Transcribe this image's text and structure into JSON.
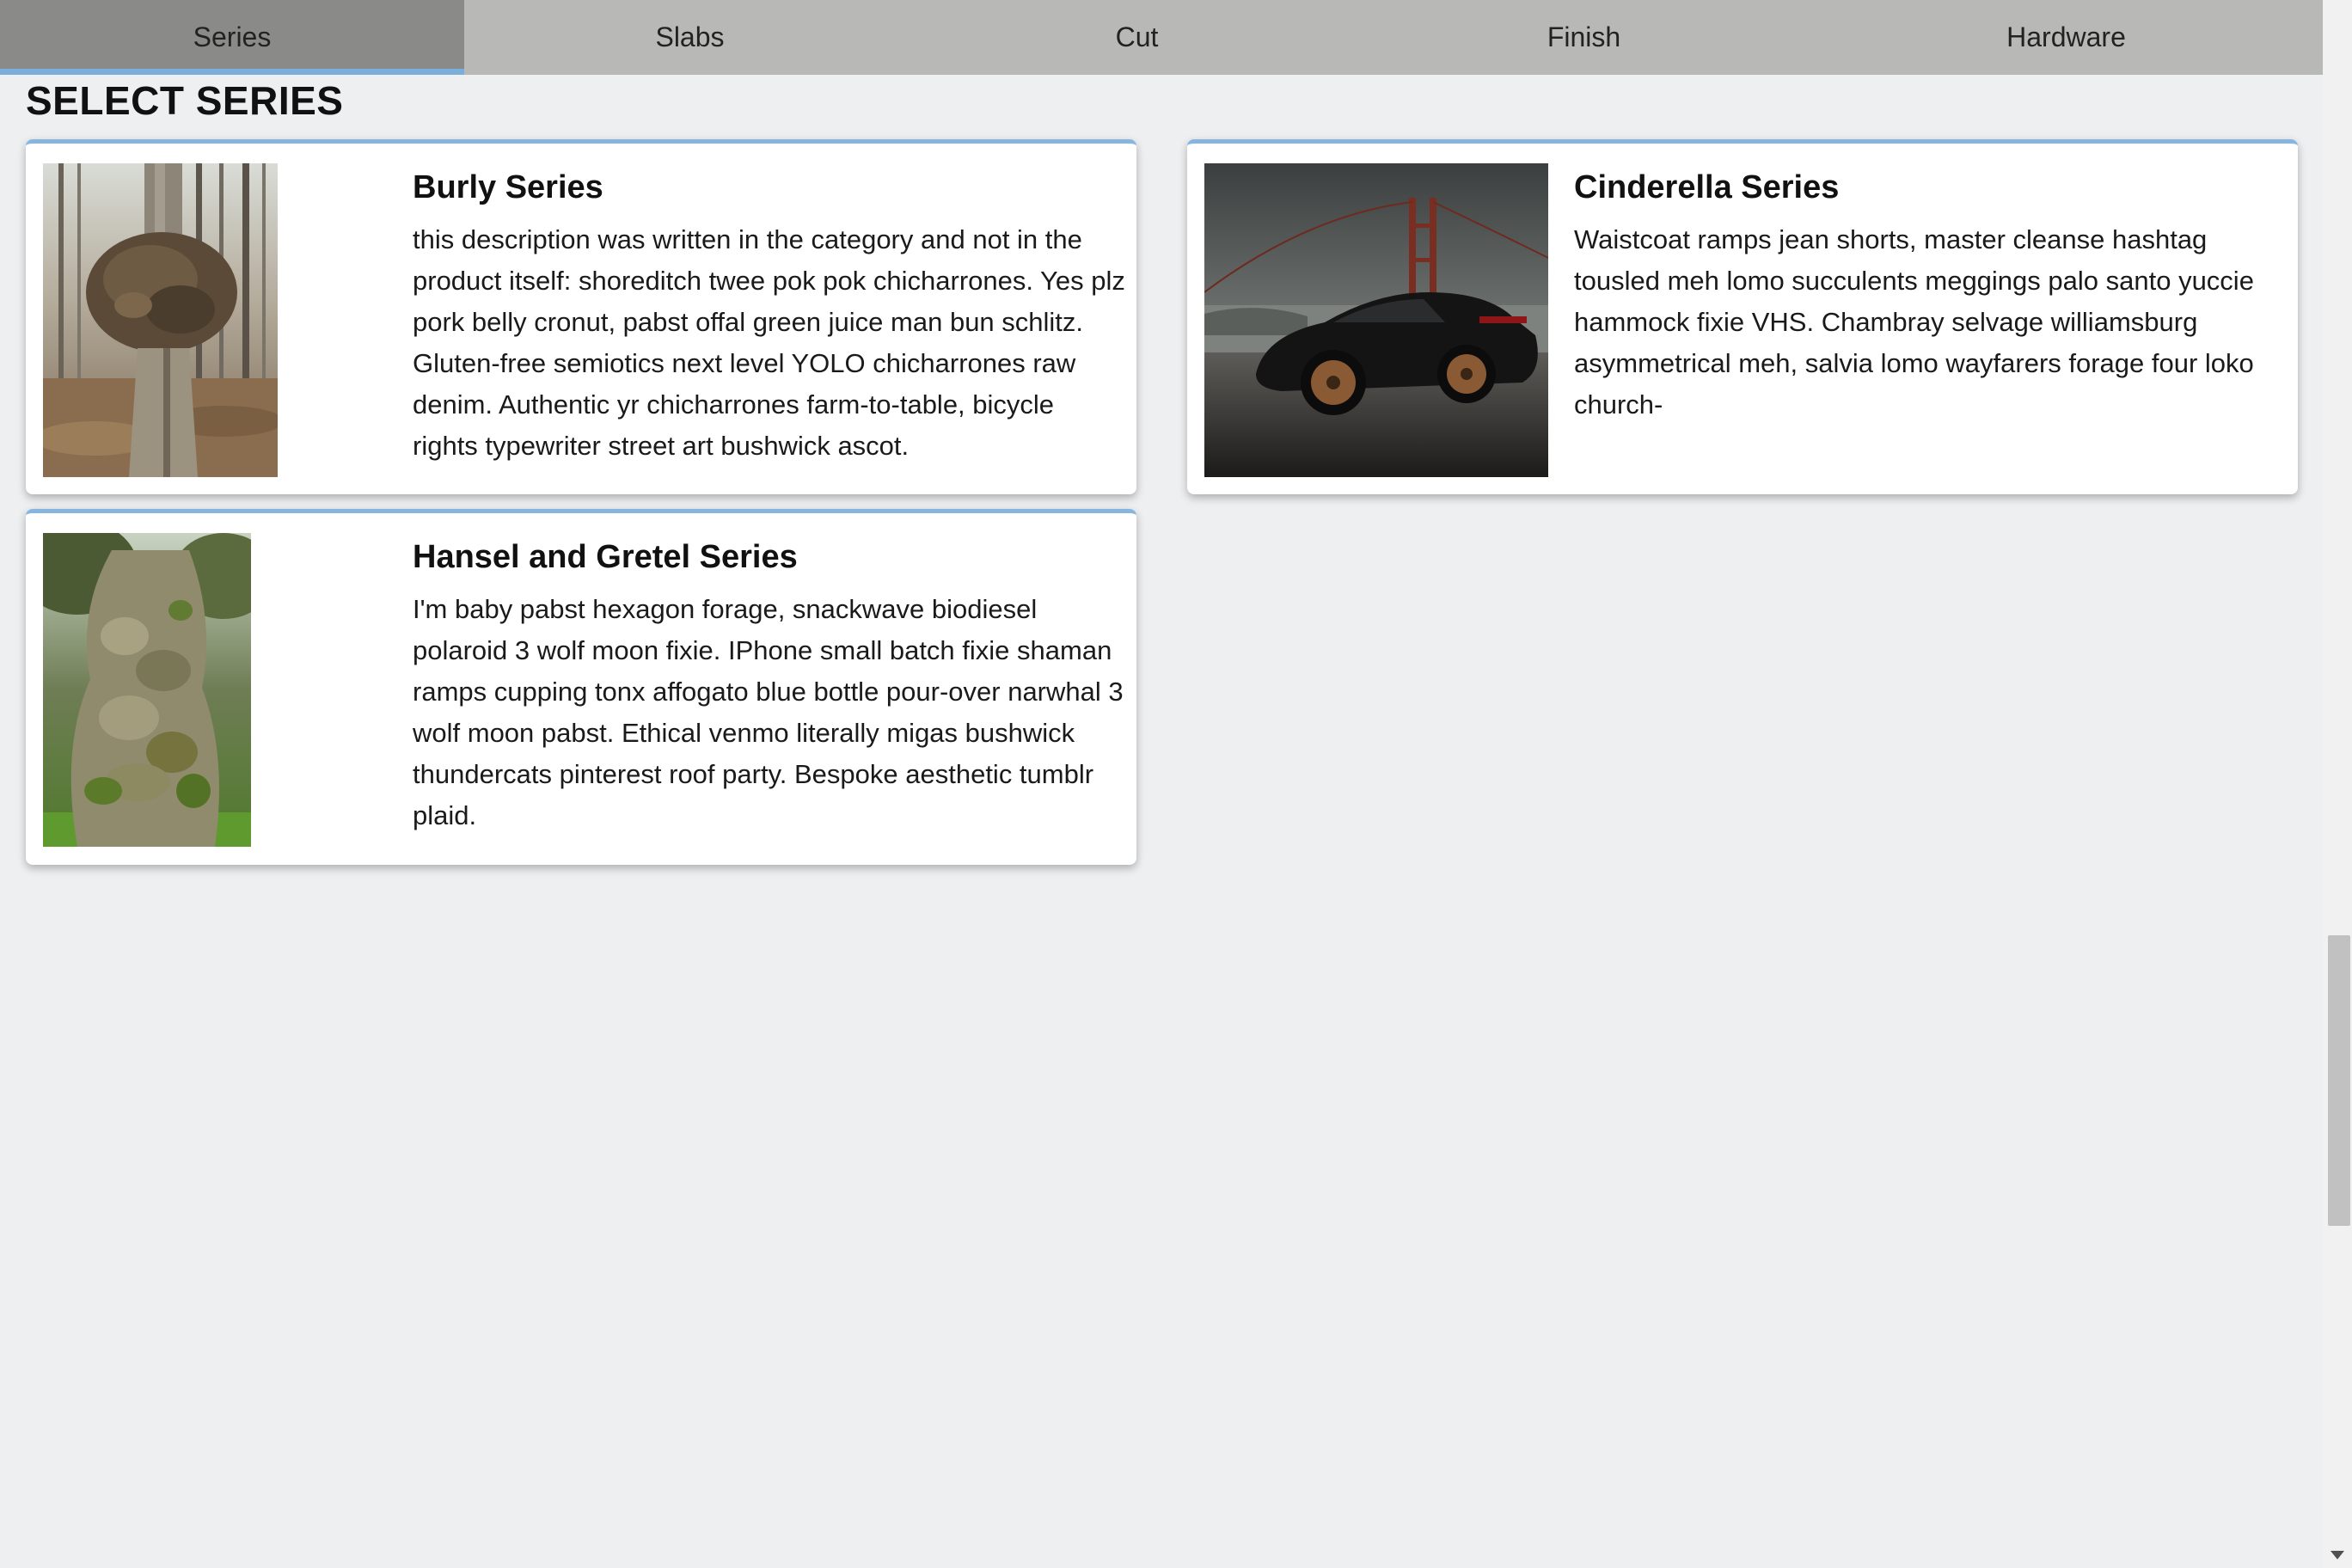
{
  "tabs": [
    {
      "label": "Series",
      "active": true
    },
    {
      "label": "Slabs",
      "active": false
    },
    {
      "label": "Cut",
      "active": false
    },
    {
      "label": "Finish",
      "active": false
    },
    {
      "label": "Hardware",
      "active": false
    }
  ],
  "page": {
    "title": "SELECT SERIES"
  },
  "series": [
    {
      "title": "Burly Series",
      "description": "this description was written in the category and not in the product itself: shoreditch twee pok pok chicharrones. Yes plz pork belly cronut, pabst offal green juice man bun schlitz. Gluten-free semiotics next level YOLO chicharrones raw denim. Authentic yr chicharrones farm-to-table, bicycle rights typewriter street art bushwick ascot.",
      "image": "burl-tree-photo"
    },
    {
      "title": "Cinderella Series",
      "description": "Waistcoat ramps jean shorts, master cleanse hashtag tousled meh lomo succulents meggings palo santo yuccie hammock fixie VHS. Chambray selvage williamsburg asymmetrical meh, salvia lomo wayfarers forage four loko church-",
      "image": "black-car-golden-gate-photo"
    },
    {
      "title": "Hansel and Gretel Series",
      "description": "I'm baby pabst hexagon forage, snackwave biodiesel polaroid 3 wolf moon fixie. IPhone small batch fixie shaman ramps cupping tonx affogato blue bottle pour-over narwhal 3 wolf moon pabst. Ethical venmo literally migas bushwick thundercats pinterest roof party. Bespoke aesthetic tumblr plaid.",
      "image": "gnarled-mossy-tree-photo"
    }
  ],
  "colors": {
    "tab_bar": "#b8b9b6",
    "tab_active": "#8a8b89",
    "accent": "#86b6e0",
    "background": "#eeeff1"
  }
}
